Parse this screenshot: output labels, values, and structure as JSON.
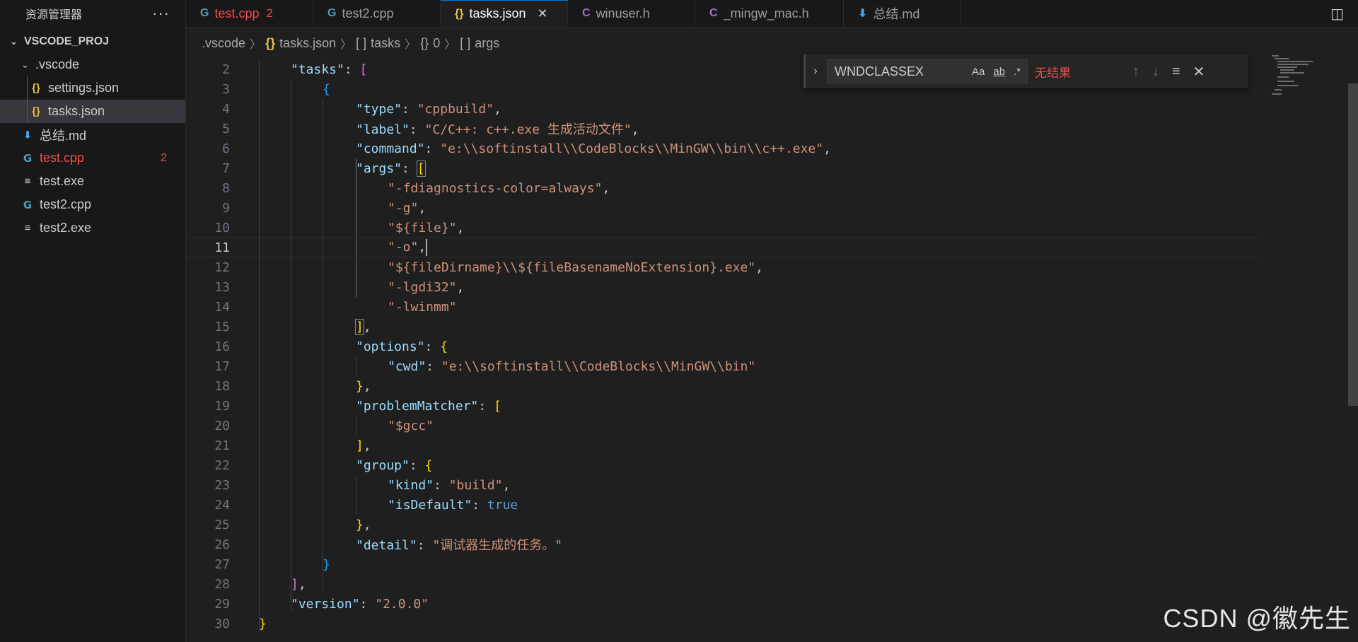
{
  "sidebar": {
    "title": "资源管理器",
    "more": "···",
    "project": "VSCODE_PROJ",
    "items": [
      {
        "label": ".vscode",
        "icon": "chevron-down",
        "badge": ""
      },
      {
        "label": "settings.json",
        "icon": "{}",
        "badge": ""
      },
      {
        "label": "tasks.json",
        "icon": "{}",
        "badge": ""
      },
      {
        "label": "总结.md",
        "icon": "⬇",
        "badge": ""
      },
      {
        "label": "test.cpp",
        "icon": "G",
        "badge": "2"
      },
      {
        "label": "test.exe",
        "icon": "≡",
        "badge": ""
      },
      {
        "label": "test2.cpp",
        "icon": "G",
        "badge": ""
      },
      {
        "label": "test2.exe",
        "icon": "≡",
        "badge": ""
      }
    ]
  },
  "tabs": [
    {
      "label": "test.cpp",
      "icon": "G",
      "badge": "2"
    },
    {
      "label": "test2.cpp",
      "icon": "G",
      "badge": ""
    },
    {
      "label": "tasks.json",
      "icon": "{}",
      "close": "✕"
    },
    {
      "label": "winuser.h",
      "icon": "C"
    },
    {
      "label": "_mingw_mac.h",
      "icon": "C"
    },
    {
      "label": "总结.md",
      "icon": "⬇"
    }
  ],
  "breadcrumb": [
    {
      "label": ".vscode",
      "icon": ""
    },
    {
      "label": "tasks.json",
      "icon": "{}"
    },
    {
      "label": "tasks",
      "icon": "[ ]"
    },
    {
      "label": "0",
      "icon": "{}"
    },
    {
      "label": "args",
      "icon": "[ ]"
    }
  ],
  "find": {
    "value": "WNDCLASSEX",
    "opt_case": "Aa",
    "opt_word": "ab",
    "opt_regex": ".*",
    "result": "无结果"
  },
  "editor": {
    "line_numbers": [
      "2",
      "3",
      "4",
      "5",
      "6",
      "7",
      "8",
      "9",
      "10",
      "11",
      "12",
      "13",
      "14",
      "15",
      "16",
      "17",
      "18",
      "19",
      "20",
      "21",
      "22",
      "23",
      "24",
      "25",
      "26",
      "27",
      "28",
      "29",
      "30"
    ],
    "current_line": "11",
    "strings": {
      "tasks": "\"tasks\"",
      "type": "\"type\"",
      "type_v": "\"cppbuild\"",
      "label": "\"label\"",
      "label_v": "\"C/C++: c++.exe 生成活动文件\"",
      "command": "\"command\"",
      "command_v": "\"e:\\\\softinstall\\\\CodeBlocks\\\\MinGW\\\\bin\\\\c++.exe\"",
      "args": "\"args\"",
      "a1": "\"-fdiagnostics-color=always\"",
      "a2": "\"-g\"",
      "a3": "\"${file}\"",
      "a4": "\"-o\"",
      "a5": "\"${fileDirname}\\\\${fileBasenameNoExtension}.exe\"",
      "a6": "\"-lgdi32\"",
      "a7": "\"-lwinmm\"",
      "options": "\"options\"",
      "cwd": "\"cwd\"",
      "cwd_v": "\"e:\\\\softinstall\\\\CodeBlocks\\\\MinGW\\\\bin\"",
      "problemMatcher": "\"problemMatcher\"",
      "pm_v": "\"$gcc\"",
      "group": "\"group\"",
      "kind": "\"kind\"",
      "kind_v": "\"build\"",
      "isDefault": "\"isDefault\"",
      "isDefault_v": "true",
      "detail": "\"detail\"",
      "detail_v": "\"调试器生成的任务。\"",
      "version": "\"version\"",
      "version_v": "\"2.0.0\""
    }
  },
  "watermark": "CSDN @徽先生"
}
